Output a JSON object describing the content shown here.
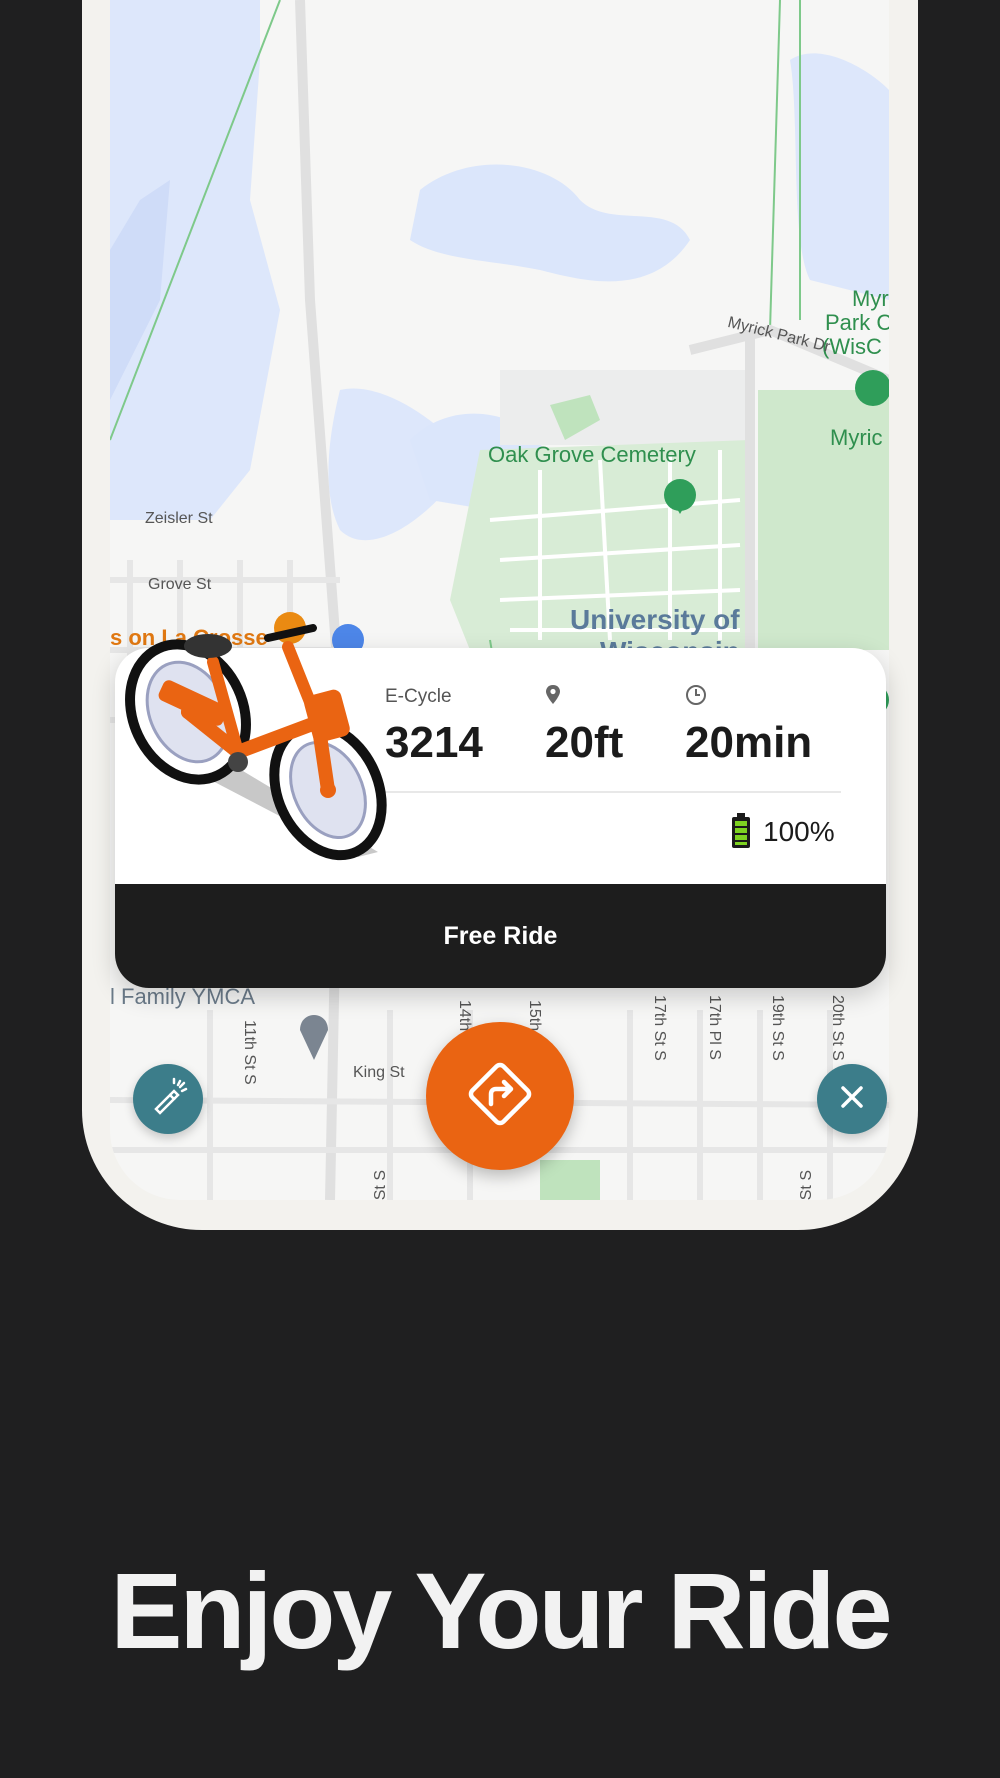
{
  "map": {
    "labels": {
      "myrick_park_line1": "Myr",
      "myrick_park_line2": "Park C",
      "myrick_park_line3": "(WisC",
      "myrick_park_dr": "Myrick Park Dr",
      "myrick_right": "Myric",
      "oak_grove": "Oak Grove Cemetery",
      "zeisler": "Zeisler St",
      "grove": "Grove St",
      "university_line1": "University of",
      "university_line2": "Wisconsin",
      "la_crosse": "s on La Crosse",
      "ymca": "l Family YMCA",
      "king": "King St",
      "s11": "11th St S",
      "s14": "14th",
      "s15": "15th",
      "s17": "17th St S",
      "s17pl": "17th Pl S",
      "s19": "19th St S",
      "s20": "20th St S",
      "st_s_left": "St S",
      "st_s_right": "St S"
    }
  },
  "ride_card": {
    "vehicle_label": "E-Cycle",
    "vehicle_id": "3214",
    "distance": "20ft",
    "eta": "20min",
    "battery": "100%",
    "cta_label": "Free Ride",
    "icons": {
      "distance": "location-pin-icon",
      "time": "clock-icon",
      "battery": "battery-icon"
    }
  },
  "buttons": {
    "left": "flashlight-icon",
    "main": "directions-icon",
    "right": "close-icon"
  },
  "colors": {
    "accent": "#ea6412",
    "teal": "#3c7d8a",
    "dark": "#1f1f20",
    "battery": "#7ed321"
  },
  "headline": "Enjoy Your Ride"
}
